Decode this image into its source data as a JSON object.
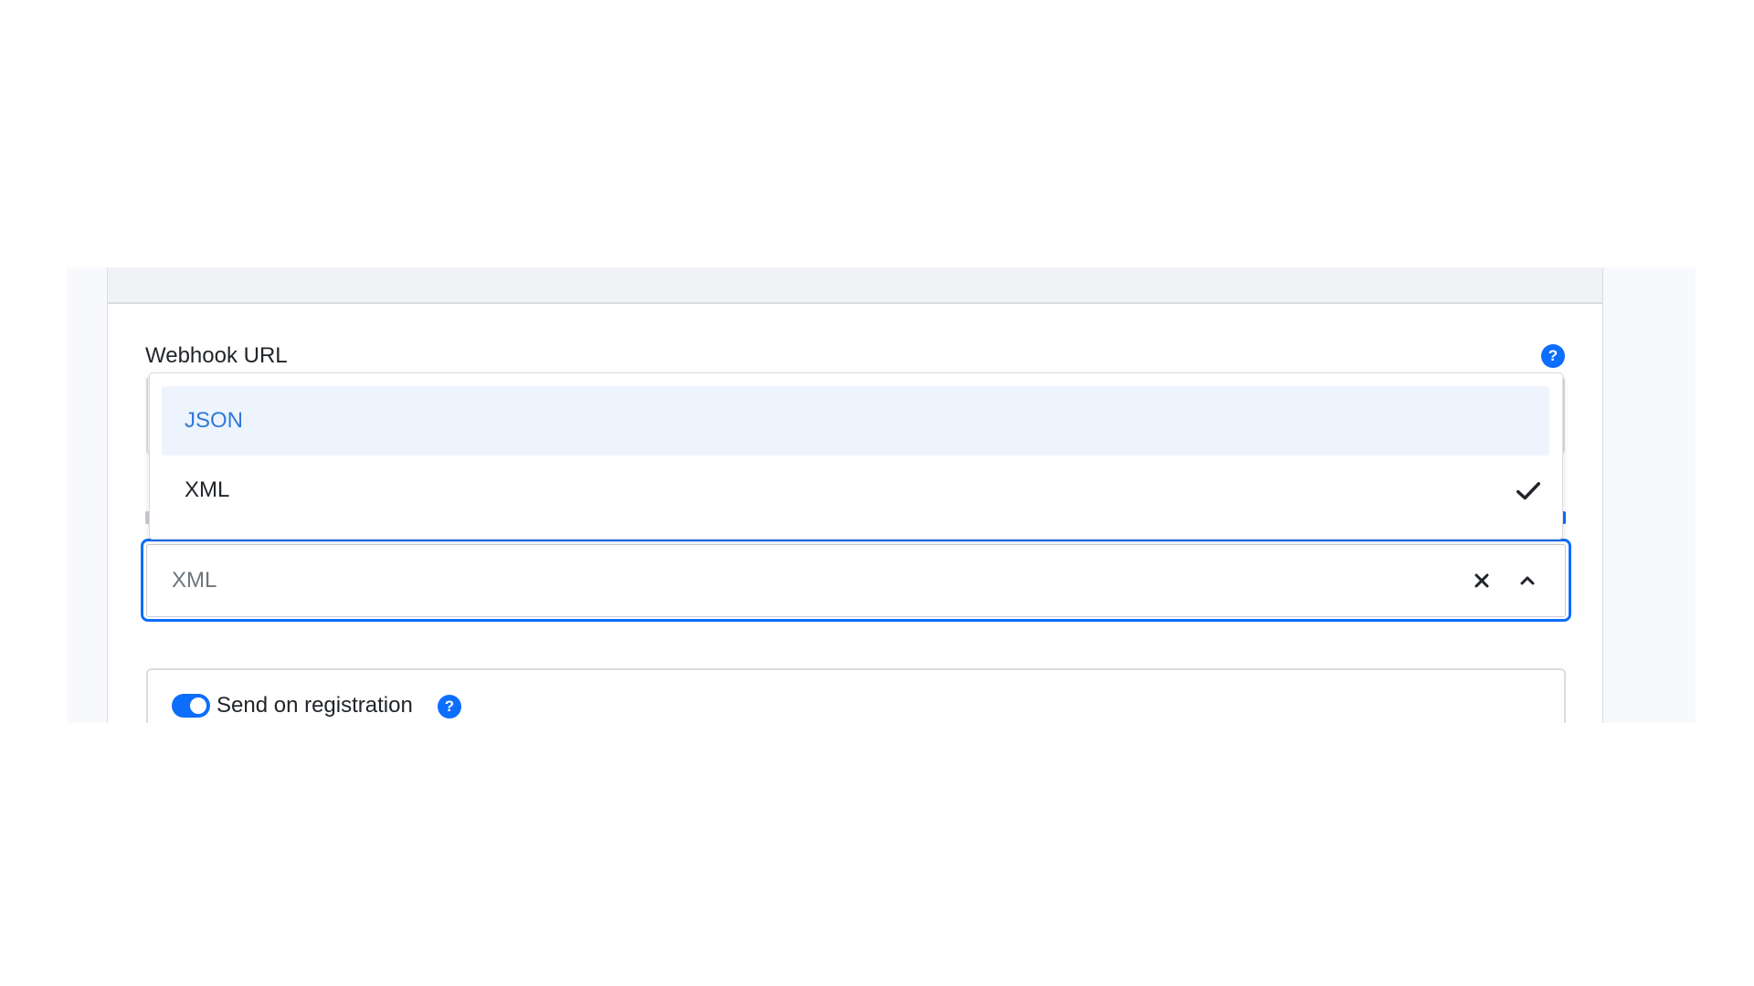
{
  "webhook": {
    "label": "Webhook URL",
    "help_icon": "question-circle-icon"
  },
  "format_select": {
    "selected": "XML",
    "options": [
      {
        "label": "JSON",
        "highlighted": true,
        "selected": false
      },
      {
        "label": "XML",
        "highlighted": false,
        "selected": true
      }
    ],
    "check_icon": "check-icon",
    "clear_icon": "close-icon",
    "chevron_icon": "chevron-up-icon"
  },
  "send_on_registration": {
    "label": "Send on registration",
    "enabled": true,
    "help_icon": "question-circle-icon"
  },
  "colors": {
    "accent": "#0d6efd",
    "option_highlight_bg": "#edf4fe",
    "option_highlight_text": "#2f7ad9"
  }
}
